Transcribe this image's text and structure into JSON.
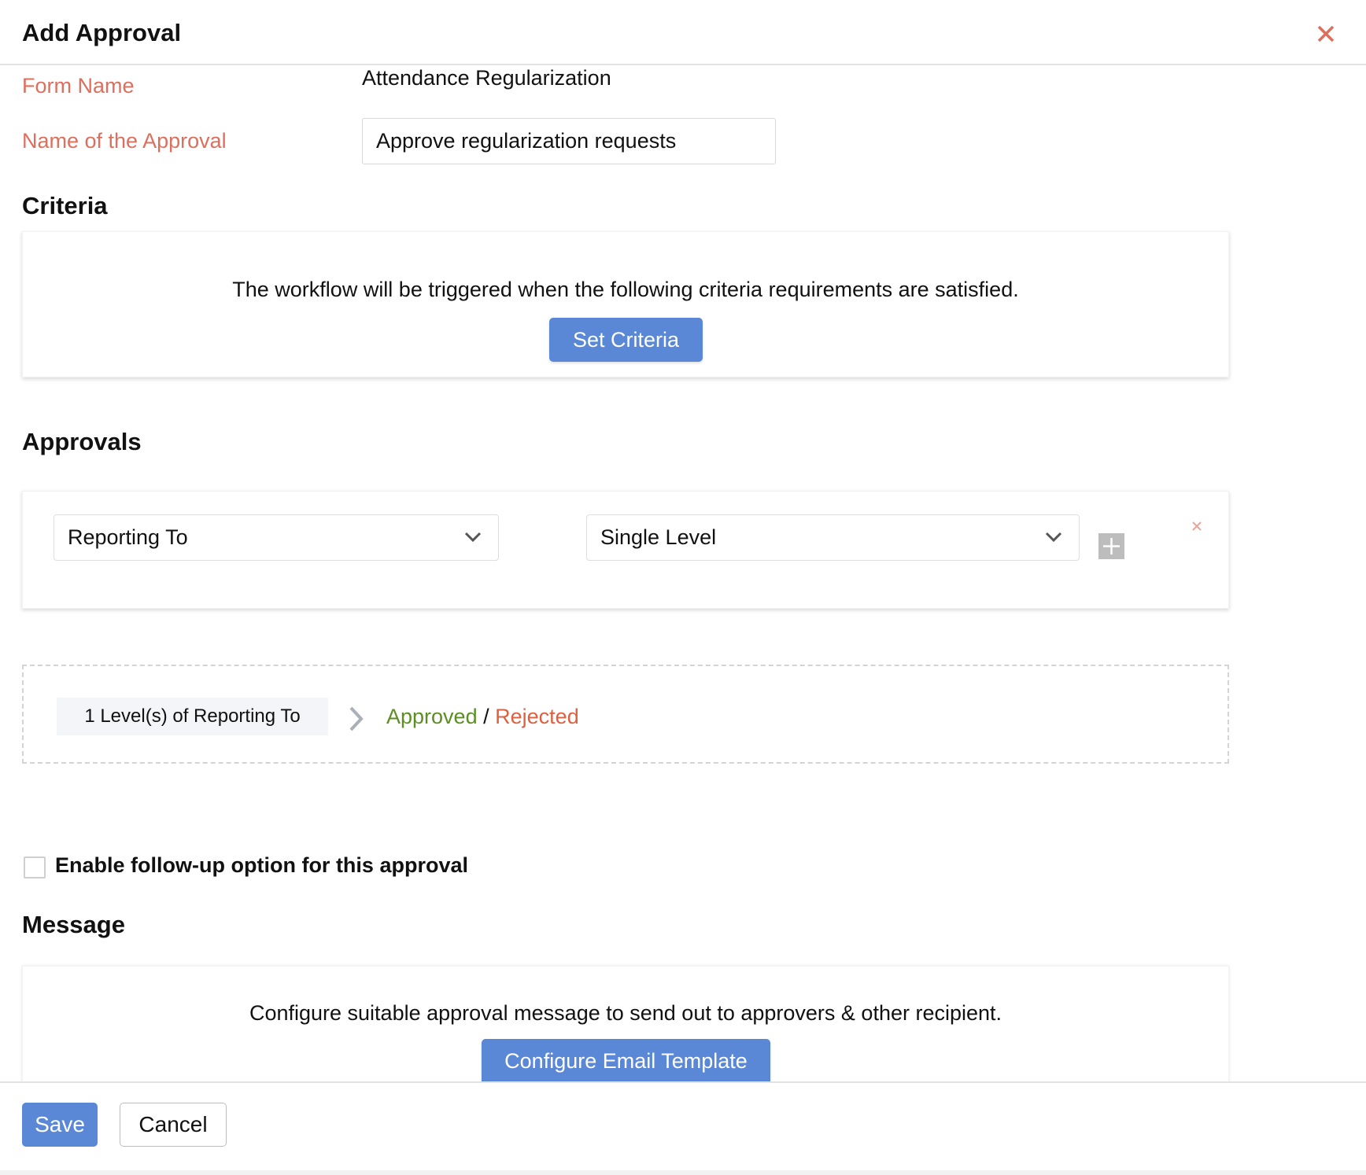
{
  "header": {
    "title": "Add Approval",
    "close_icon": "close-icon",
    "close_color": "#dd6f5e"
  },
  "form": {
    "form_name_label": "Form Name",
    "form_name_value": "Attendance Regularization",
    "approval_name_label": "Name of the Approval",
    "approval_name_value": "Approve regularization requests"
  },
  "criteria": {
    "heading": "Criteria",
    "description": "The workflow will be triggered when the following criteria requirements are satisfied.",
    "button_label": "Set Criteria"
  },
  "approvals": {
    "heading": "Approvals",
    "approver_type_selected": "Reporting To",
    "level_type_selected": "Single Level",
    "add_icon": "plus-icon",
    "remove_icon": "close-icon"
  },
  "flow": {
    "level_summary": "1 Level(s) of Reporting To",
    "arrow_icon": "chevron-right-icon",
    "approved_label": "Approved",
    "separator": "/",
    "rejected_label": "Rejected",
    "approved_color": "#5b8f22",
    "rejected_color": "#dd6040"
  },
  "followup": {
    "checked": false,
    "label": "Enable follow-up option for this approval"
  },
  "message": {
    "heading": "Message",
    "description": "Configure suitable approval message to send out to approvers & other recipient.",
    "button_label": "Configure Email Template"
  },
  "footer": {
    "save_label": "Save",
    "cancel_label": "Cancel"
  },
  "colors": {
    "primary": "#5b88d6",
    "label_accent": "#dd6f5e"
  }
}
